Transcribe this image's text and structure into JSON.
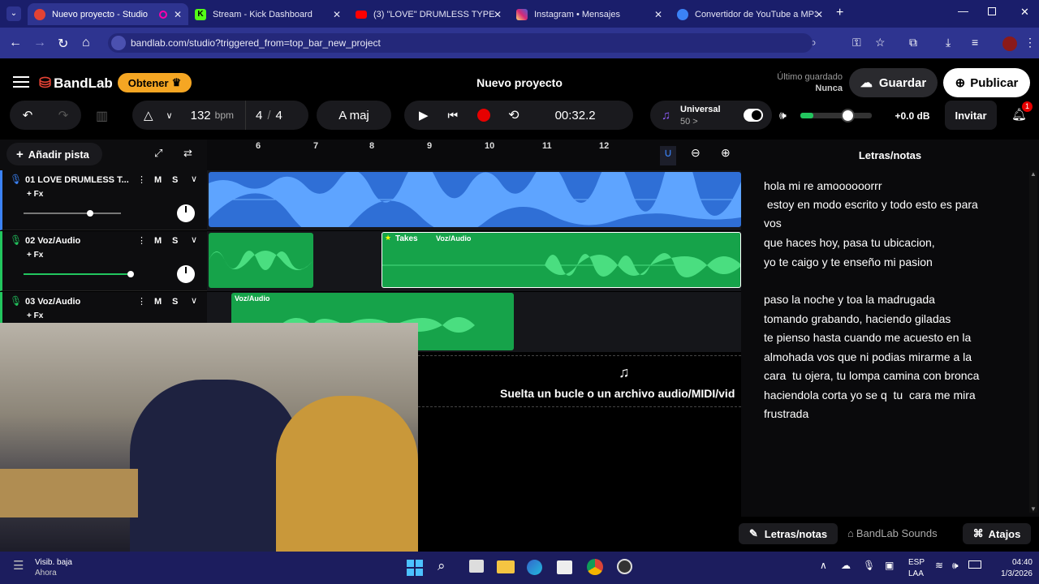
{
  "browser": {
    "tabs": [
      {
        "title": "Nuevo proyecto - Studio",
        "color": "#e34234"
      },
      {
        "title": "Stream - Kick Dashboard",
        "color": "#53fc18"
      },
      {
        "title": "(3) \"LOVE\" DRUMLESS TYPE BE",
        "color": "#ff0000"
      },
      {
        "title": "Instagram • Mensajes",
        "color": "#d6249f"
      },
      {
        "title": "Convertidor de YouTube a MP3",
        "color": "#3b82f6"
      }
    ],
    "url": "bandlab.com/studio?triggered_from=top_bar_new_project"
  },
  "header": {
    "brand": "BandLab",
    "obtener": "Obtener",
    "project_title": "Nuevo proyecto",
    "last_saved_label": "Último guardado",
    "last_saved_value": "Nunca",
    "save": "Guardar",
    "publish": "Publicar"
  },
  "toolbar": {
    "bpm": "132",
    "bpm_unit": "bpm",
    "time_sig_num": "4",
    "time_sig_sep": "/",
    "time_sig_den": "4",
    "key": "A maj",
    "time": "00:32.2",
    "preset_name": "Universal",
    "preset_value": "50 >",
    "volume_db": "+0.0 dB",
    "invite": "Invitar",
    "notif_count": "1"
  },
  "tracks": {
    "add_track": "Añadir pista",
    "items": [
      {
        "name": "01  LOVE DRUMLESS T...",
        "fx": "+ Fx",
        "mute": "M",
        "solo": "S",
        "color": "#3b82f6",
        "volume": 0.55
      },
      {
        "name": "02  Voz/Audio",
        "fx": "+ Fx",
        "mute": "M",
        "solo": "S",
        "color": "#22c55e",
        "volume": 0.9
      },
      {
        "name": "03  Voz/Audio",
        "fx": "+ Fx",
        "mute": "M",
        "solo": "S",
        "color": "#22c55e",
        "volume": 0.9
      }
    ]
  },
  "timeline": {
    "ticks": [
      "6",
      "7",
      "8",
      "9",
      "10",
      "11",
      "12"
    ],
    "clip_takes": "Takes",
    "clip_voz": "Voz/Audio",
    "clip_voz2": "Voz/Audio",
    "drop_text": "Suelta un bucle o un archivo audio/MIDI/vid"
  },
  "lyrics": {
    "title": "Letras/notas",
    "lines": [
      "hola mi re amoooooorrr",
      " estoy en modo escrito y todo esto es para",
      "vos",
      "que haces hoy, pasa tu ubicacion,",
      "yo te caigo y te enseño mi pasion",
      "",
      "paso la noche y toa la madrugada",
      "tomando grabando, haciendo giladas",
      "te pienso hasta cuando me acuesto en la",
      "almohada vos que ni podias mirarme a la",
      "cara  tu ojera, tu lompa camina con bronca",
      "haciendola corta yo se q  tu  cara me mira",
      "frustrada"
    ]
  },
  "bottom_tabs": {
    "lyrics": "Letras/notas",
    "sounds": "BandLab Sounds",
    "shortcuts": "Atajos"
  },
  "taskbar": {
    "weather_line1": "Visib. baja",
    "weather_line2": "Ahora",
    "lang1": "ESP",
    "lang2": "LAA",
    "time": "04:40",
    "date": "1/3/2026"
  }
}
